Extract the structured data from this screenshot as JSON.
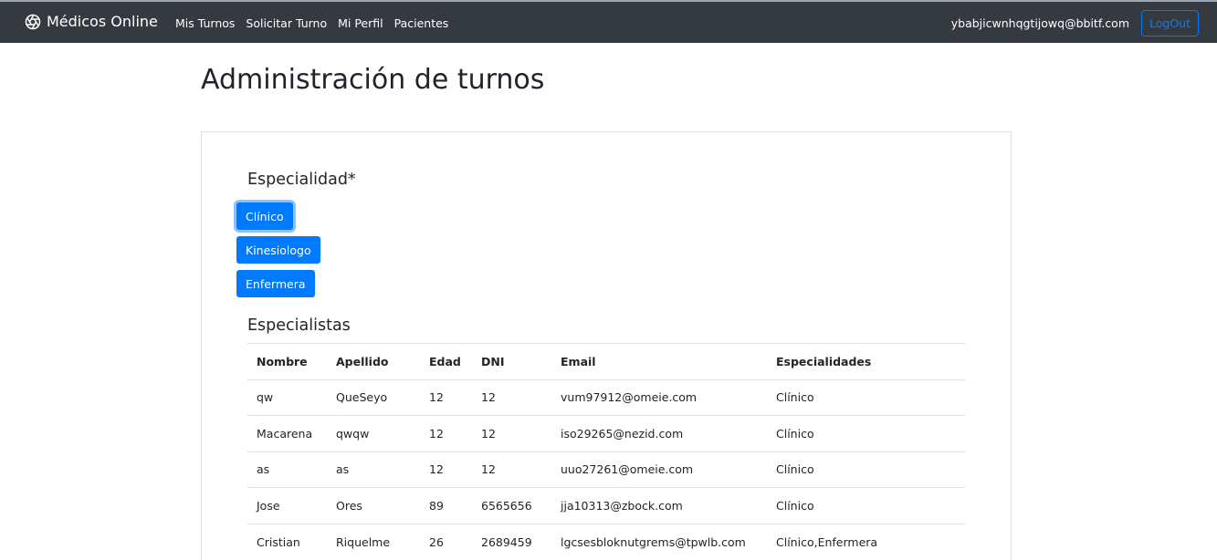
{
  "navbar": {
    "brand": "Médicos Online",
    "links": [
      "Mis Turnos",
      "Solicitar Turno",
      "Mi Perfil",
      "Pacientes"
    ],
    "user_email": "ybabjicwnhqgtijowq@bbitf.com",
    "logout_label": "LogOut"
  },
  "page": {
    "title": "Administración de turnos"
  },
  "specialty": {
    "title": "Especialidad*",
    "options": [
      "Clínico",
      "Kinesiologo",
      "Enfermera"
    ],
    "selected": "Clínico"
  },
  "specialists": {
    "title": "Especialistas",
    "columns": [
      "Nombre",
      "Apellido",
      "Edad",
      "DNI",
      "Email",
      "Especialidades"
    ],
    "rows": [
      [
        "qw",
        "QueSeyo",
        "12",
        "12",
        "vum97912@omeie.com",
        "Clínico"
      ],
      [
        "Macarena",
        "qwqw",
        "12",
        "12",
        "iso29265@nezid.com",
        "Clínico"
      ],
      [
        "as",
        "as",
        "12",
        "12",
        "uuo27261@omeie.com",
        "Clínico"
      ],
      [
        "Jose",
        "Ores",
        "89",
        "6565656",
        "jja10313@zbock.com",
        "Clínico"
      ],
      [
        "Cristian",
        "Riquelme",
        "26",
        "2689459",
        "lgcsesbloknutgrems@tpwlb.com",
        "Clínico,Enfermera"
      ]
    ]
  },
  "colors": {
    "navbar_bg": "#343a40",
    "primary": "#007bff"
  }
}
